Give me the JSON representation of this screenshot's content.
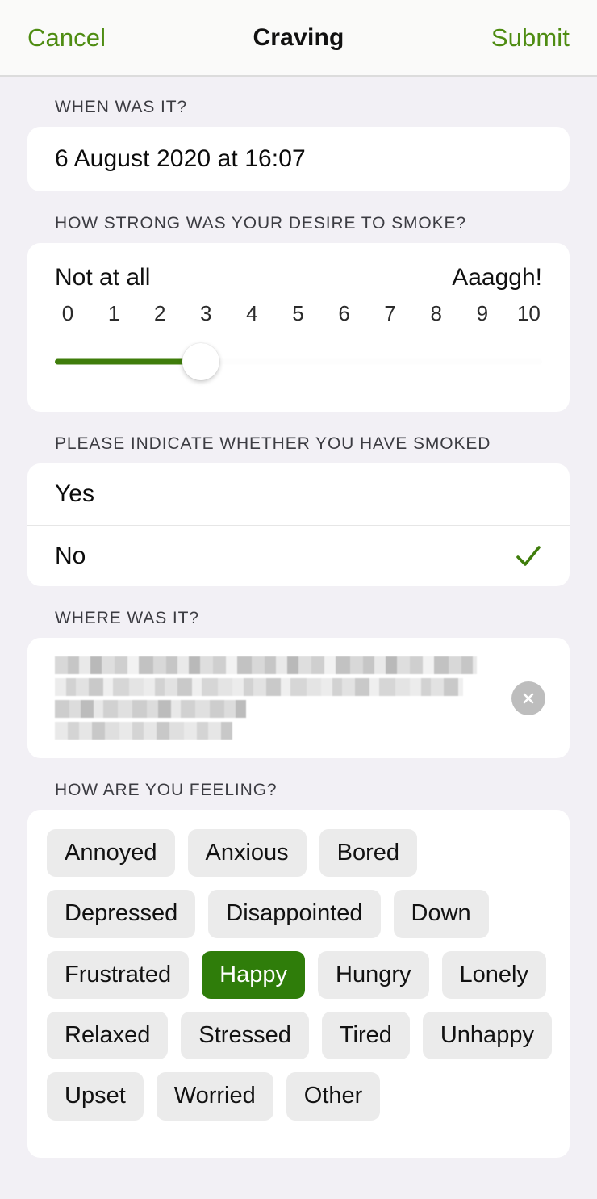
{
  "header": {
    "cancel_label": "Cancel",
    "title": "Craving",
    "submit_label": "Submit",
    "accent_color": "#4e8c12"
  },
  "when_section": {
    "label": "WHEN WAS IT?",
    "value": "6 August 2020 at 16:07"
  },
  "desire_section": {
    "label": "HOW STRONG WAS YOUR DESIRE TO SMOKE?",
    "min_label": "Not at all",
    "max_label": "Aaaggh!",
    "ticks": [
      "0",
      "1",
      "2",
      "3",
      "4",
      "5",
      "6",
      "7",
      "8",
      "9",
      "10"
    ],
    "value": 3,
    "min": 0,
    "max": 10,
    "fill_color": "#3f7d0b"
  },
  "smoked_section": {
    "label": "PLEASE INDICATE WHETHER YOU HAVE SMOKED",
    "options": [
      {
        "label": "Yes",
        "selected": false
      },
      {
        "label": "No",
        "selected": true
      }
    ],
    "check_color": "#3f7d0b"
  },
  "where_section": {
    "label": "WHERE WAS IT?",
    "value": "",
    "redacted": true,
    "clear_icon": "close-circle-icon"
  },
  "feeling_section": {
    "label": "HOW ARE YOU FEELING?",
    "selected": "Happy",
    "selected_color": "#2f7d0a",
    "rows": [
      [
        "Annoyed",
        "Anxious",
        "Bored"
      ],
      [
        "Depressed",
        "Disappointed",
        "Down"
      ],
      [
        "Frustrated",
        "Happy",
        "Hungry",
        "Lonely"
      ],
      [
        "Relaxed",
        "Stressed",
        "Tired",
        "Unhappy"
      ],
      [
        "Upset",
        "Worried",
        "Other"
      ]
    ]
  }
}
